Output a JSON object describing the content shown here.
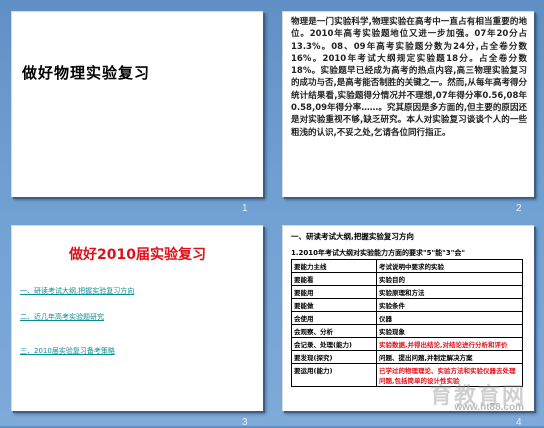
{
  "slides": [
    {
      "number": "1",
      "title": "做好物理实验复习"
    },
    {
      "number": "2",
      "text": "物理是一门实验科学,物理实验在高考中一直占有相当重要的地位。2010年高考实验题地位又进一步加强。07年20分占13.3%。08、09年高考实验题分数为24分,占全卷分数16%。2010年考试大纲规定实验题18分。占全卷分数18%。实验题早已经成为高考的热点内容,高三物理实验复习的成功与否,是高考能否制胜的关键之一。然而,从每年高考得分统计结果看,实验题得分情况并不理想,07年得分率0.56,08年0.58,09年得分率……。究其原因是多方面的,但主要的原因还是对实验重视不够,缺乏研究。本人对实验复习谈谈个人的一些粗浅的认识,不妥之处,乞请各位同行指正。"
    },
    {
      "number": "3",
      "title": "做好2010届实验复习",
      "links": [
        "一、研读考试大纲,把握实验复习方向",
        "二、近几年高考实验题研究",
        "三、2010届实验复习备考策略"
      ]
    },
    {
      "number": "4",
      "heading": "一、研读考试大纲,把握实验复习方向",
      "subheading": "1.2010年考试大纲对实验能力方面的要求\"5\"能\"3\"会\"",
      "table": [
        [
          "要能力主线",
          "考试说明中要求的实验"
        ],
        [
          "要能看",
          "实验目的"
        ],
        [
          "要能用",
          "实验原理和方法"
        ],
        [
          "要能做",
          "实验条件"
        ],
        [
          "会使用",
          "仪器"
        ],
        [
          "会观察、分析",
          "实验现象"
        ],
        [
          "会记录、处理(能力)",
          "实验数据,并得出结论,对结论进行分析和评价"
        ],
        [
          "要发现(探究)",
          "问题、提出问题,并制定解决方案"
        ],
        [
          "要运用(能力)",
          "已学过的物理理论、实验方法和实验仪器去处理问题,包括简单的设计性实验"
        ]
      ],
      "red_rows": [
        6,
        8
      ]
    }
  ],
  "watermark": {
    "text": "育教育网",
    "url": "www.ht88.com"
  }
}
